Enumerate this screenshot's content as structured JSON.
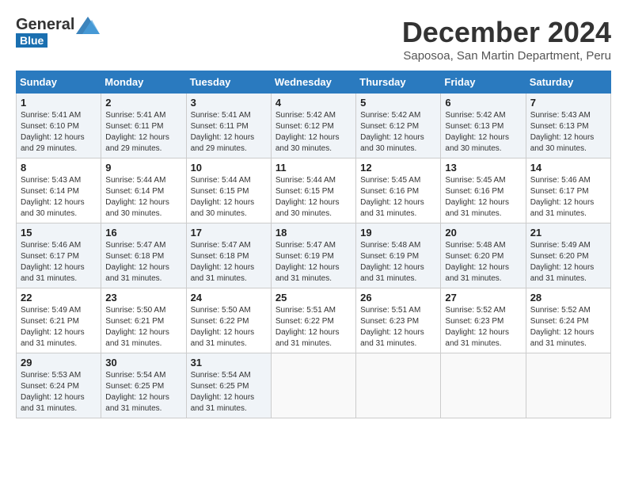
{
  "header": {
    "logo_general": "General",
    "logo_blue": "Blue",
    "month": "December 2024",
    "location": "Saposoa, San Martin Department, Peru"
  },
  "weekdays": [
    "Sunday",
    "Monday",
    "Tuesday",
    "Wednesday",
    "Thursday",
    "Friday",
    "Saturday"
  ],
  "weeks": [
    [
      {
        "day": "1",
        "sunrise": "5:41 AM",
        "sunset": "6:10 PM",
        "daylight": "12 hours and 29 minutes."
      },
      {
        "day": "2",
        "sunrise": "5:41 AM",
        "sunset": "6:11 PM",
        "daylight": "12 hours and 29 minutes."
      },
      {
        "day": "3",
        "sunrise": "5:41 AM",
        "sunset": "6:11 PM",
        "daylight": "12 hours and 29 minutes."
      },
      {
        "day": "4",
        "sunrise": "5:42 AM",
        "sunset": "6:12 PM",
        "daylight": "12 hours and 30 minutes."
      },
      {
        "day": "5",
        "sunrise": "5:42 AM",
        "sunset": "6:12 PM",
        "daylight": "12 hours and 30 minutes."
      },
      {
        "day": "6",
        "sunrise": "5:42 AM",
        "sunset": "6:13 PM",
        "daylight": "12 hours and 30 minutes."
      },
      {
        "day": "7",
        "sunrise": "5:43 AM",
        "sunset": "6:13 PM",
        "daylight": "12 hours and 30 minutes."
      }
    ],
    [
      {
        "day": "8",
        "sunrise": "5:43 AM",
        "sunset": "6:14 PM",
        "daylight": "12 hours and 30 minutes."
      },
      {
        "day": "9",
        "sunrise": "5:44 AM",
        "sunset": "6:14 PM",
        "daylight": "12 hours and 30 minutes."
      },
      {
        "day": "10",
        "sunrise": "5:44 AM",
        "sunset": "6:15 PM",
        "daylight": "12 hours and 30 minutes."
      },
      {
        "day": "11",
        "sunrise": "5:44 AM",
        "sunset": "6:15 PM",
        "daylight": "12 hours and 30 minutes."
      },
      {
        "day": "12",
        "sunrise": "5:45 AM",
        "sunset": "6:16 PM",
        "daylight": "12 hours and 31 minutes."
      },
      {
        "day": "13",
        "sunrise": "5:45 AM",
        "sunset": "6:16 PM",
        "daylight": "12 hours and 31 minutes."
      },
      {
        "day": "14",
        "sunrise": "5:46 AM",
        "sunset": "6:17 PM",
        "daylight": "12 hours and 31 minutes."
      }
    ],
    [
      {
        "day": "15",
        "sunrise": "5:46 AM",
        "sunset": "6:17 PM",
        "daylight": "12 hours and 31 minutes."
      },
      {
        "day": "16",
        "sunrise": "5:47 AM",
        "sunset": "6:18 PM",
        "daylight": "12 hours and 31 minutes."
      },
      {
        "day": "17",
        "sunrise": "5:47 AM",
        "sunset": "6:18 PM",
        "daylight": "12 hours and 31 minutes."
      },
      {
        "day": "18",
        "sunrise": "5:47 AM",
        "sunset": "6:19 PM",
        "daylight": "12 hours and 31 minutes."
      },
      {
        "day": "19",
        "sunrise": "5:48 AM",
        "sunset": "6:19 PM",
        "daylight": "12 hours and 31 minutes."
      },
      {
        "day": "20",
        "sunrise": "5:48 AM",
        "sunset": "6:20 PM",
        "daylight": "12 hours and 31 minutes."
      },
      {
        "day": "21",
        "sunrise": "5:49 AM",
        "sunset": "6:20 PM",
        "daylight": "12 hours and 31 minutes."
      }
    ],
    [
      {
        "day": "22",
        "sunrise": "5:49 AM",
        "sunset": "6:21 PM",
        "daylight": "12 hours and 31 minutes."
      },
      {
        "day": "23",
        "sunrise": "5:50 AM",
        "sunset": "6:21 PM",
        "daylight": "12 hours and 31 minutes."
      },
      {
        "day": "24",
        "sunrise": "5:50 AM",
        "sunset": "6:22 PM",
        "daylight": "12 hours and 31 minutes."
      },
      {
        "day": "25",
        "sunrise": "5:51 AM",
        "sunset": "6:22 PM",
        "daylight": "12 hours and 31 minutes."
      },
      {
        "day": "26",
        "sunrise": "5:51 AM",
        "sunset": "6:23 PM",
        "daylight": "12 hours and 31 minutes."
      },
      {
        "day": "27",
        "sunrise": "5:52 AM",
        "sunset": "6:23 PM",
        "daylight": "12 hours and 31 minutes."
      },
      {
        "day": "28",
        "sunrise": "5:52 AM",
        "sunset": "6:24 PM",
        "daylight": "12 hours and 31 minutes."
      }
    ],
    [
      {
        "day": "29",
        "sunrise": "5:53 AM",
        "sunset": "6:24 PM",
        "daylight": "12 hours and 31 minutes."
      },
      {
        "day": "30",
        "sunrise": "5:54 AM",
        "sunset": "6:25 PM",
        "daylight": "12 hours and 31 minutes."
      },
      {
        "day": "31",
        "sunrise": "5:54 AM",
        "sunset": "6:25 PM",
        "daylight": "12 hours and 31 minutes."
      },
      null,
      null,
      null,
      null
    ]
  ]
}
